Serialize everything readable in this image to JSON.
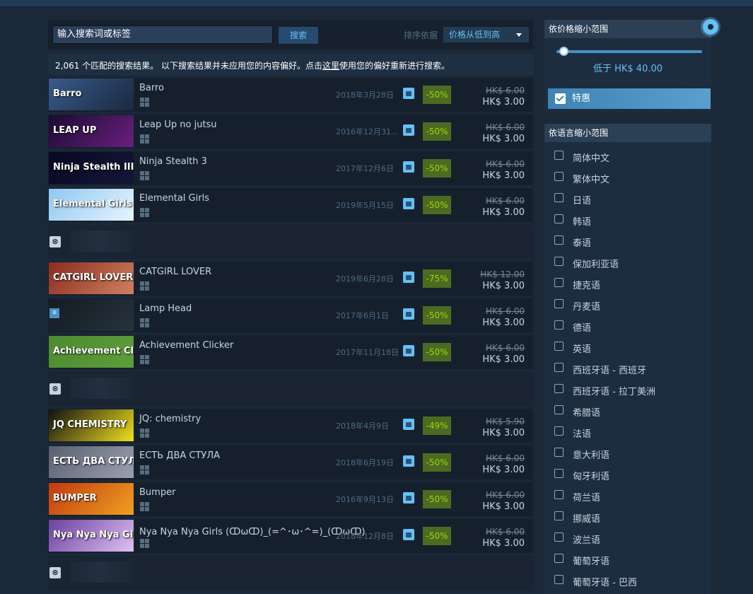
{
  "search": {
    "value": "输入搜索词或标签",
    "button_label": "搜索",
    "sort_label": "排序依据",
    "sort_value": "价格从低到高"
  },
  "info": {
    "prefix": "2,061 个匹配的搜索结果。 以下搜索结果并未应用您的内容偏好。点击",
    "link": "这里",
    "suffix": "使用您的偏好重新进行搜索。"
  },
  "results": [
    {
      "title": "Barro",
      "date": "2018年3月28日",
      "discount": "-50%",
      "orig": "HK$ 6.00",
      "final": "HK$ 3.00",
      "thumb_text": "Barro",
      "thumb_colors": [
        "#3a5a8a",
        "#1a2a40"
      ]
    },
    {
      "title": "Leap Up no jutsu",
      "date": "2016年12月31...",
      "discount": "-50%",
      "orig": "HK$ 6.00",
      "final": "HK$ 3.00",
      "thumb_text": "LEAP UP",
      "thumb_colors": [
        "#1a0a30",
        "#6a2080"
      ]
    },
    {
      "title": "Ninja Stealth 3",
      "date": "2017年12月6日",
      "discount": "-50%",
      "orig": "HK$ 6.00",
      "final": "HK$ 3.00",
      "thumb_text": "Ninja Stealth III",
      "thumb_colors": [
        "#080820",
        "#15153a"
      ]
    },
    {
      "title": "Elemental Girls",
      "date": "2019年5月15日",
      "discount": "-50%",
      "orig": "HK$ 6.00",
      "final": "HK$ 3.00",
      "thumb_text": "Elemental Girls",
      "thumb_colors": [
        "#8fc8f0",
        "#e8f4ff"
      ]
    },
    {
      "ignored": true
    },
    {
      "title": "CATGIRL LOVER",
      "date": "2019年6月28日",
      "discount": "-75%",
      "orig": "HK$ 12.00",
      "final": "HK$ 3.00",
      "thumb_text": "CATGIRL LOVER",
      "thumb_colors": [
        "#8a2c20",
        "#d08060"
      ]
    },
    {
      "title": "Lamp Head",
      "date": "2017年6月1日",
      "discount": "-50%",
      "orig": "HK$ 6.00",
      "final": "HK$ 3.00",
      "thumb_text": "",
      "thumb_colors": [
        "#141c24",
        "#26323c"
      ],
      "menu": true
    },
    {
      "title": "Achievement Clicker",
      "date": "2017年11月18日",
      "discount": "-50%",
      "orig": "HK$ 6.00",
      "final": "HK$ 3.00",
      "thumb_text": "Achievement Clicker",
      "thumb_colors": [
        "#4c8a30",
        "#5e9e3a"
      ]
    },
    {
      "ignored": true
    },
    {
      "title": "JQ: chemistry",
      "date": "2018年4月9日",
      "discount": "-49%",
      "orig": "HK$ 5.90",
      "final": "HK$ 3.00",
      "thumb_text": "JQ CHEMISTRY",
      "thumb_colors": [
        "#101010",
        "#f0e020"
      ]
    },
    {
      "title": "ЕСТЬ ДВА СТУЛА",
      "date": "2018年6月19日",
      "discount": "-50%",
      "orig": "HK$ 6.00",
      "final": "HK$ 3.00",
      "thumb_text": "ЕСТЬ ДВА СТУЛА",
      "thumb_colors": [
        "#5a6070",
        "#9aa0b0"
      ]
    },
    {
      "title": "Bumper",
      "date": "2016年9月13日",
      "discount": "-50%",
      "orig": "HK$ 6.00",
      "final": "HK$ 3.00",
      "thumb_text": "BUMPER",
      "thumb_colors": [
        "#c03a10",
        "#f0a020"
      ]
    },
    {
      "title": "Nya Nya Nya Girls (ↀωↀ)_(=^･ω･^=)_(ↀωↀ)",
      "date": "2018年12月8日",
      "discount": "-50%",
      "orig": "HK$ 6.00",
      "final": "HK$ 3.00",
      "thumb_text": "Nya Nya Nya Girls",
      "thumb_colors": [
        "#6a40a0",
        "#e0c0f0"
      ]
    },
    {
      "ignored": true
    }
  ],
  "sidebar": {
    "price_header": "依价格缩小范围",
    "price_label": "低于 HK$ 40.00",
    "price_fraction": 0.05,
    "special_label": "特惠",
    "lang_header": "依语言缩小范围",
    "languages": [
      "简体中文",
      "繁体中文",
      "日语",
      "韩语",
      "泰语",
      "保加利亚语",
      "捷克语",
      "丹麦语",
      "德语",
      "英语",
      "西班牙语 - 西班牙",
      "西班牙语 - 拉丁美洲",
      "希腊语",
      "法语",
      "意大利语",
      "匈牙利语",
      "荷兰语",
      "挪威语",
      "波兰语",
      "葡萄牙语",
      "葡萄牙语 - 巴西"
    ]
  },
  "colors": {
    "accent": "#66c0f4",
    "discount_bg": "#4c6b22",
    "discount_fg": "#a4d007",
    "background": "#1b2838"
  }
}
